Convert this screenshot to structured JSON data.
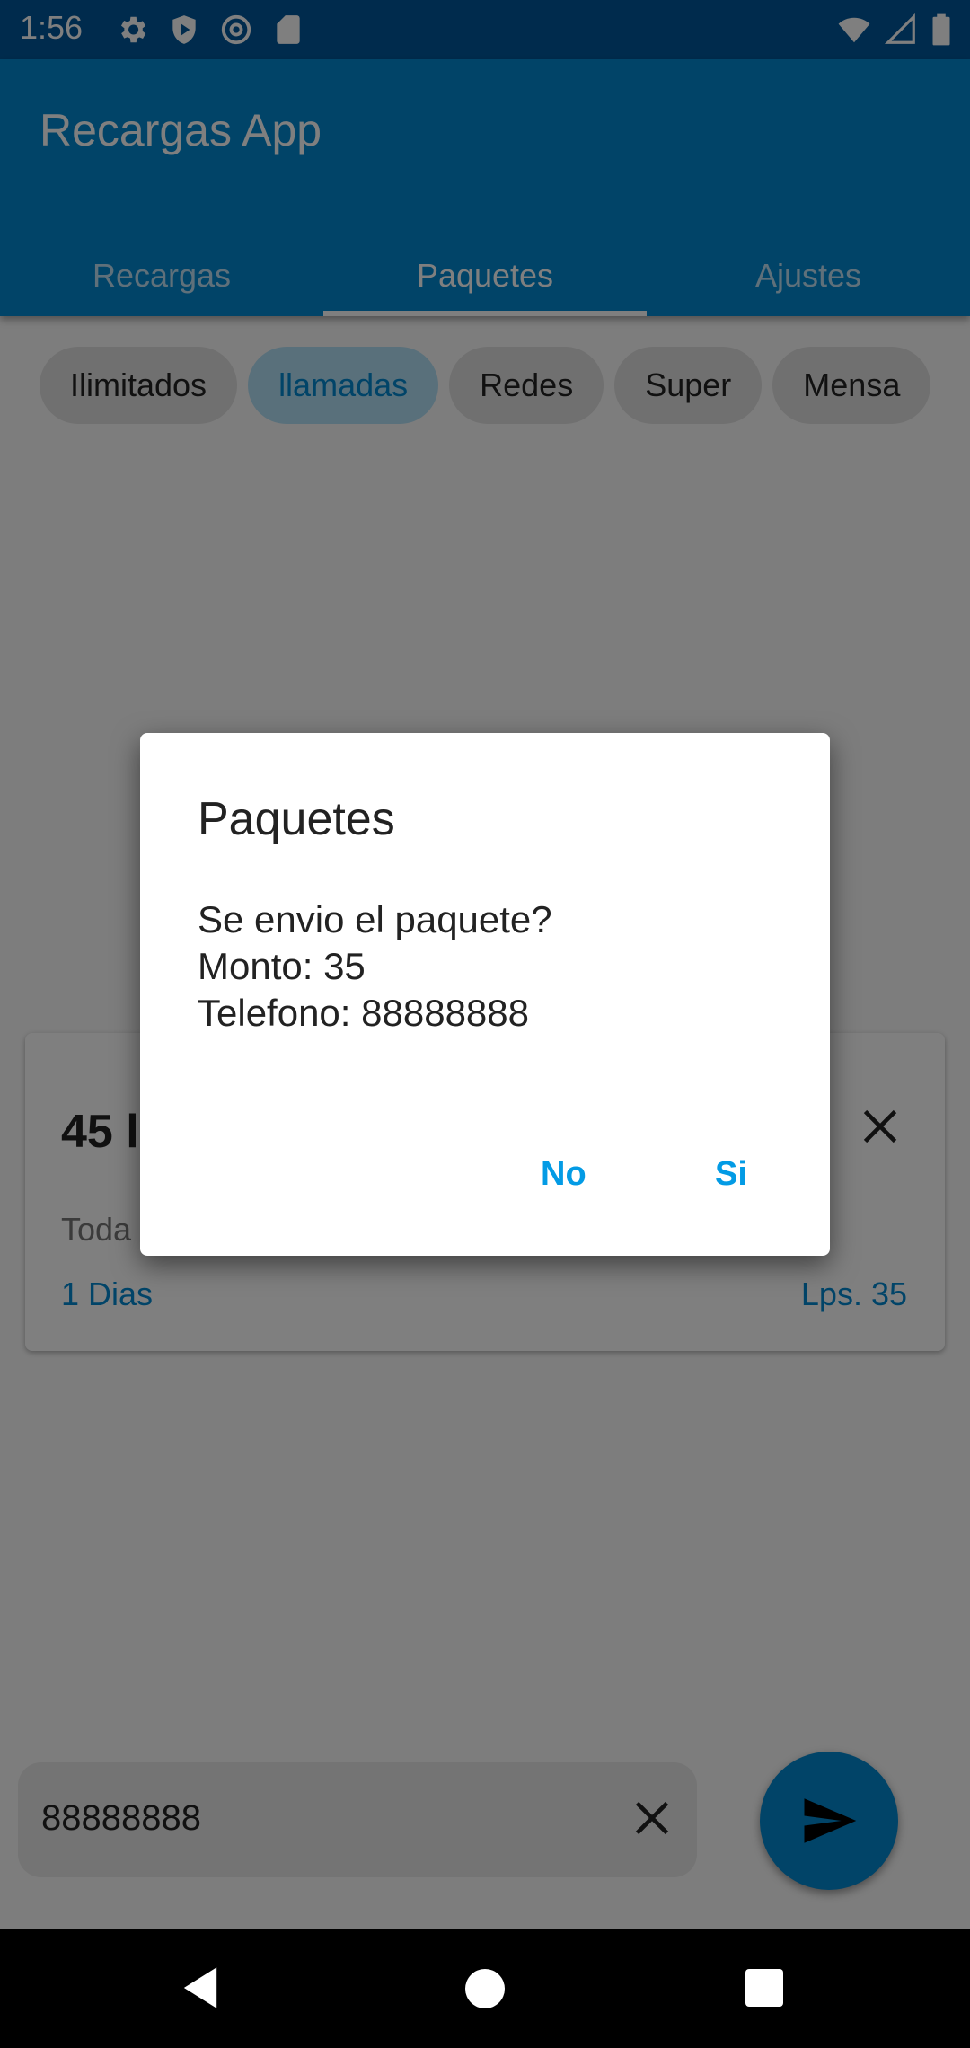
{
  "status_bar": {
    "time": "1:56",
    "icons_left": [
      "gear-icon",
      "shield-play-icon",
      "at-sign-icon",
      "sd-card-icon"
    ],
    "icons_right": [
      "wifi-icon",
      "cell-signal-icon",
      "battery-icon"
    ]
  },
  "app_bar": {
    "title": "Recargas App"
  },
  "tabs": [
    {
      "label": "Recargas"
    },
    {
      "label": "Paquetes"
    },
    {
      "label": "Ajustes"
    }
  ],
  "chips": [
    {
      "label": "Ilimitados"
    },
    {
      "label": "llamadas"
    },
    {
      "label": "Redes"
    },
    {
      "label": "Super"
    },
    {
      "label": "Mensa"
    }
  ],
  "card": {
    "title": "45 l",
    "description": "Toda",
    "days": "1 Dias",
    "price": "Lps. 35"
  },
  "phone_field": {
    "value": "88888888"
  },
  "dialog": {
    "title": "Paquetes",
    "message_line1": "Se envio el paquete?",
    "message_line2": "Monto: 35",
    "message_line3": "Telefono: 88888888",
    "no_label": "No",
    "si_label": "Si"
  },
  "colors": {
    "primary": "#0288d1",
    "primary_dark": "#01579b",
    "accent": "#039be5",
    "chip_selected_bg": "#b3e0f6"
  }
}
